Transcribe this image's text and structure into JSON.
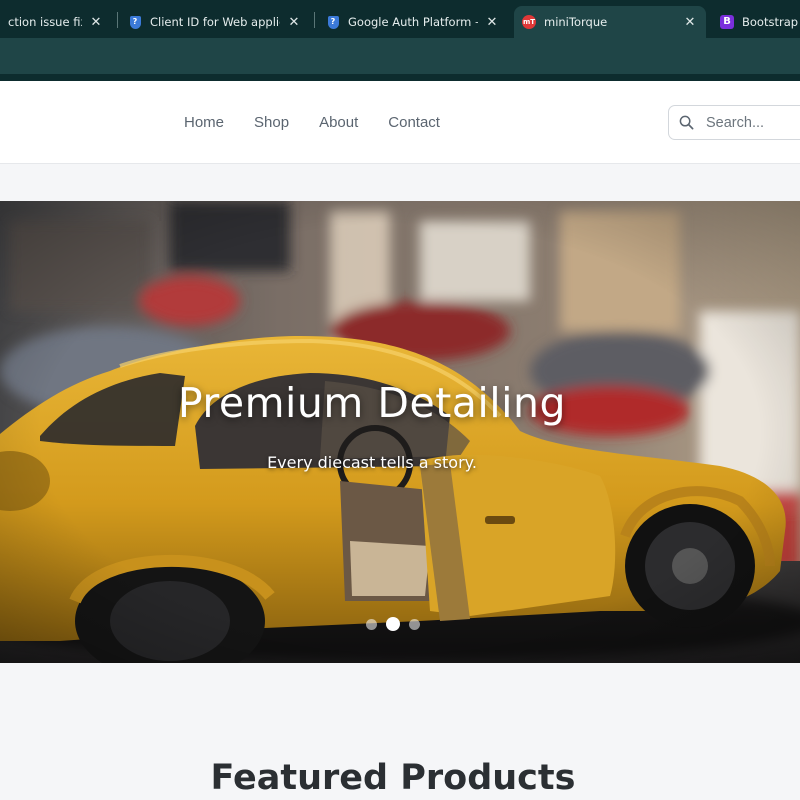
{
  "browser": {
    "tabs": [
      {
        "title": "ction issue fix",
        "icon": "none",
        "active": false
      },
      {
        "title": "Client ID for Web applicatio",
        "icon": "google-cloud-shield-icon",
        "active": false
      },
      {
        "title": "Google Auth Platform – My",
        "icon": "google-cloud-shield-icon",
        "active": false
      },
      {
        "title": "miniTorque",
        "icon": "minitorque-favicon",
        "active": true
      },
      {
        "title": "Bootstrap · T",
        "icon": "bootstrap-favicon",
        "active": false
      }
    ],
    "close_glyph": "✕"
  },
  "navbar": {
    "links": [
      "Home",
      "Shop",
      "About",
      "Contact"
    ],
    "search_placeholder": "Search..."
  },
  "hero": {
    "title": "Premium Detailing",
    "subtitle": "Every diecast tells a story.",
    "slide_count": 3,
    "active_slide": 2
  },
  "featured": {
    "title": "Featured Products"
  },
  "colors": {
    "tabbar": "#0d2c2e",
    "active_tab": "#1f4547",
    "car_body": "#d9a21e",
    "page_bg": "#f5f6f8"
  }
}
